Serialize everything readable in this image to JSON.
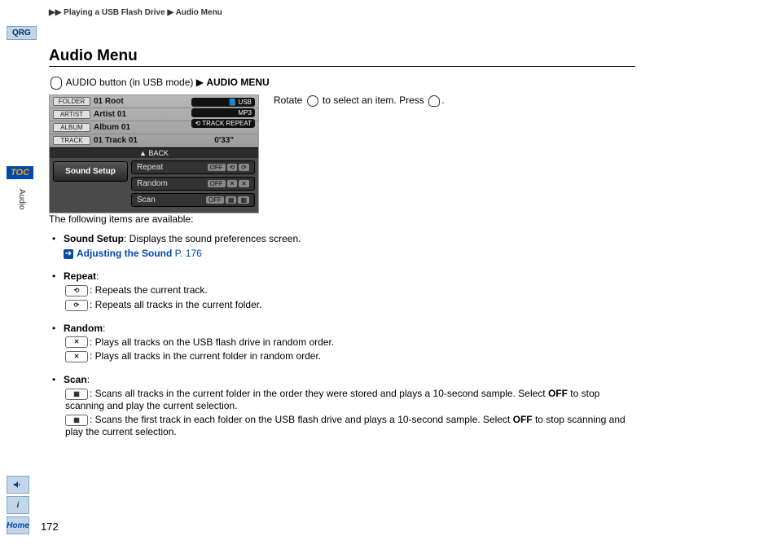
{
  "sidebar": {
    "qrg": "QRG",
    "toc": "TOC",
    "audio": "Audio",
    "voice_icon_alt": "voice",
    "info_icon": "i",
    "home": "Home"
  },
  "breadcrumb": {
    "a": "Playing a USB Flash Drive",
    "b": "Audio Menu"
  },
  "title": "Audio Menu",
  "step": {
    "pre": "AUDIO button (in USB mode)",
    "arrow": "▶",
    "bold": "AUDIO MENU"
  },
  "instruction": {
    "rotate_pre": "Rotate ",
    "rotate_mid": " to select an item. Press ",
    "rotate_end": "."
  },
  "screenshot": {
    "rows": [
      {
        "label": "FOLDER",
        "val": "01 Root"
      },
      {
        "label": "ARTIST",
        "val": "Artist 01"
      },
      {
        "label": "ALBUM",
        "val": "Album 01"
      },
      {
        "label": "TRACK",
        "val": "01 Track 01"
      }
    ],
    "time": "0'33\"",
    "badges": [
      "📘 USB",
      "MP3",
      "⟲ TRACK REPEAT"
    ],
    "back": "BACK",
    "sound_setup": "Sound Setup",
    "menu": [
      {
        "name": "Repeat",
        "icons": [
          "OFF",
          "⟲",
          "⟳"
        ]
      },
      {
        "name": "Random",
        "icons": [
          "OFF",
          "✕",
          "✕"
        ]
      },
      {
        "name": "Scan",
        "icons": [
          "OFF",
          "▦",
          "▦"
        ]
      }
    ]
  },
  "intro": "The following items are available:",
  "items": {
    "sound_setup": {
      "title": "Sound Setup",
      "desc": ": Displays the sound preferences screen.",
      "link": "Adjusting the Sound",
      "link_page": "P. 176"
    },
    "repeat": {
      "title": "Repeat",
      "colon": ":",
      "a": ": Repeats the current track.",
      "b": ": Repeats all tracks in the current folder."
    },
    "random": {
      "title": "Random",
      "colon": ":",
      "a": ": Plays all tracks on the USB flash drive in random order.",
      "b": ": Plays all tracks in the current folder in random order."
    },
    "scan": {
      "title": "Scan",
      "colon": ":",
      "a_pre": ": Scans all tracks in the current folder in the order they were stored and plays a 10-second sample. Select ",
      "a_off": "OFF",
      "a_post": " to stop scanning and play the current selection.",
      "b_pre": ": Scans the first track in each folder on the USB flash drive and plays a 10-second sample. Select ",
      "b_off": "OFF",
      "b_post": " to stop scanning and play the current selection."
    }
  },
  "page_number": "172"
}
